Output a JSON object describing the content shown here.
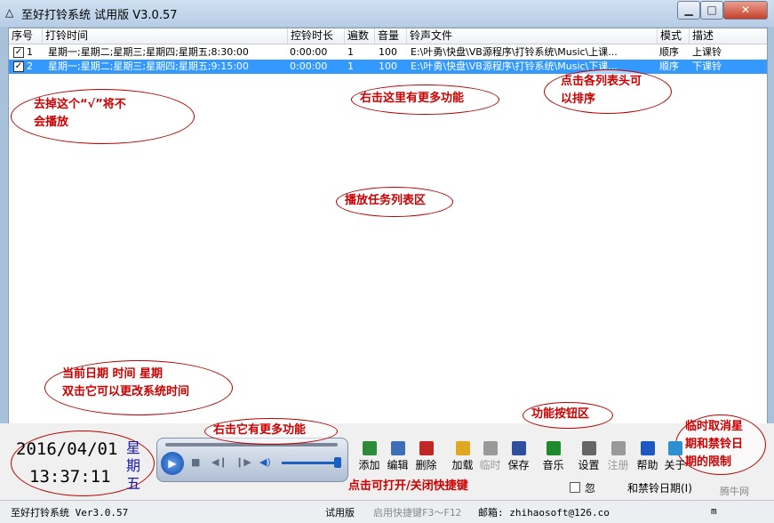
{
  "window": {
    "title": "至好打铃系统 试用版 V3.0.57",
    "min_label": "▁",
    "max_label": "□",
    "close_label": "✕"
  },
  "table": {
    "headers": [
      "序号",
      "打铃时间",
      "控铃时长",
      "遍数",
      "音量",
      "铃声文件",
      "模式",
      "描述"
    ],
    "rows": [
      {
        "checked": true,
        "selected": false,
        "no": "1",
        "time": "星期一;星期二;星期三;星期四;星期五;8:30:00",
        "dur": "0:00:00",
        "times": "1",
        "vol": "100",
        "file": "E:\\叶勇\\快盘\\VB源程序\\打铃系统\\Music\\上课...",
        "mode": "顺序",
        "desc": "上课铃"
      },
      {
        "checked": true,
        "selected": true,
        "no": "2",
        "time": "星期一;星期二;星期三;星期四;星期五;9:15:00",
        "dur": "0:00:00",
        "times": "1",
        "vol": "100",
        "file": "E:\\叶勇\\快盘\\VB源程序\\打铃系统\\Music\\下课...",
        "mode": "顺序",
        "desc": "下课铃"
      }
    ]
  },
  "annotations": {
    "checkbox_note_1": "去掉这个“√”将不",
    "checkbox_note_2": "会播放",
    "rightclick_list": "右击这里有更多功能",
    "sort_note_1": "点击各列表头可",
    "sort_note_2": "以排序",
    "list_area": "播放任务列表区",
    "datetime_note_1": "当前日期  时间  星期",
    "datetime_note_2": "双击它可以更改系统时间",
    "player_note": "右击它有更多功能",
    "buttons_note": "功能按钮区",
    "shortcut_note": "点击可打开/关闭快捷键",
    "cancel_note_1": "临时取消星",
    "cancel_note_2": "期和禁铃日",
    "cancel_note_3": "期的限制"
  },
  "clock": {
    "date": "2016/04/01",
    "time": "13:37:11",
    "weekday_1": "星",
    "weekday_2": "期",
    "weekday_3": "五"
  },
  "toolbar": [
    {
      "label": "添加",
      "icon": "add-icon",
      "color": "#2e8b3a"
    },
    {
      "label": "编辑",
      "icon": "edit-icon",
      "color": "#3c6fb8"
    },
    {
      "label": "删除",
      "icon": "delete-icon",
      "color": "#c02828"
    },
    {
      "label": "加载",
      "icon": "folder-icon",
      "color": "#e0a820"
    },
    {
      "label": "临时",
      "icon": "temp-icon",
      "color": "#999999"
    },
    {
      "label": "保存",
      "icon": "save-icon",
      "color": "#2d4f9e"
    },
    {
      "label": "音乐",
      "icon": "music-icon",
      "color": "#1f8a2c"
    },
    {
      "label": "设置",
      "icon": "gear-icon",
      "color": "#666666"
    },
    {
      "label": "注册",
      "icon": "register-icon",
      "color": "#999999"
    },
    {
      "label": "帮助",
      "icon": "help-icon",
      "color": "#1f57c2"
    },
    {
      "label": "关于",
      "icon": "globe-icon",
      "color": "#2d8fd0"
    }
  ],
  "checkbox_label": "忽",
  "checkbox_label_tail": "和禁铃日期(I)",
  "status": {
    "version": "至好打铃系统 Ver3.0.57",
    "edition": "试用版",
    "shortcut": "启用快捷键F3～F12",
    "email": "邮箱: zhihaosoft@126.co",
    "tail": "m"
  },
  "watermark": "腾牛网"
}
